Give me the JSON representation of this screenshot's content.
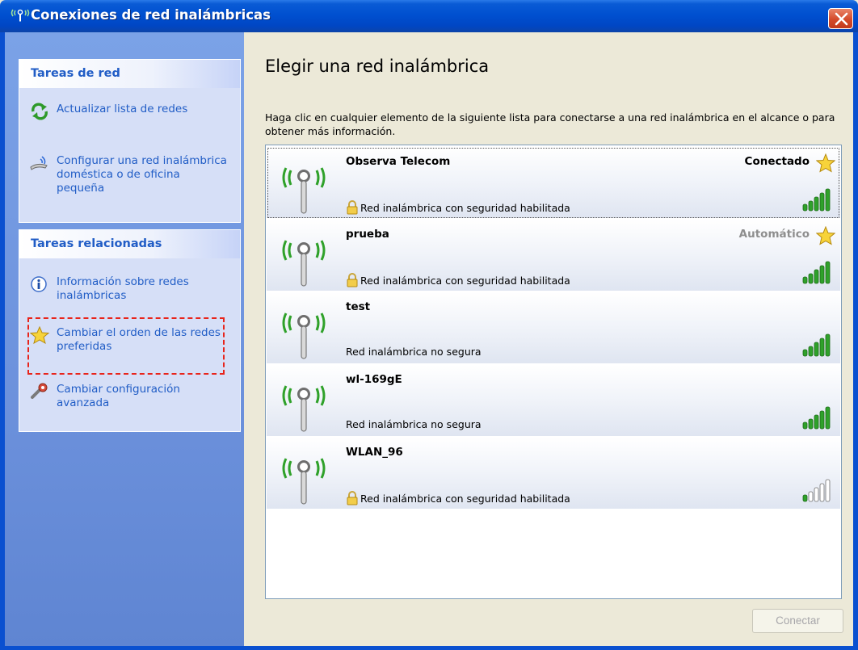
{
  "window": {
    "title": "Conexiones de red inalámbricas",
    "close_icon": "close-icon"
  },
  "tasks_network": {
    "heading": "Tareas de red",
    "items": [
      {
        "icon": "refresh-icon",
        "label": "Actualizar lista de redes"
      },
      {
        "icon": "wireless-setup-icon",
        "label": "Configurar una red inalámbrica doméstica o de oficina pequeña"
      }
    ]
  },
  "tasks_related": {
    "heading": "Tareas relacionadas",
    "items": [
      {
        "icon": "info-icon",
        "label": "Información sobre redes inalámbricas"
      },
      {
        "icon": "star-icon",
        "label": "Cambiar el orden de las redes preferidas"
      },
      {
        "icon": "settings-icon",
        "label": "Cambiar configuración avanzada"
      }
    ]
  },
  "main": {
    "title": "Elegir una red inalámbrica",
    "description": "Haga clic en cualquier elemento de la siguiente lista para conectarse a una red inalámbrica en el alcance o para obtener más información.",
    "connect_button": "Conectar"
  },
  "networks": [
    {
      "name": "Observa Telecom",
      "status": "Conectado",
      "status_color": "#000000",
      "security": "Red inalámbrica con seguridad habilitada",
      "secured": true,
      "signal_bars": 5,
      "preferred": true,
      "selected": true
    },
    {
      "name": "prueba",
      "status": "Automático",
      "status_color": "#8e8e8e",
      "security": "Red inalámbrica con seguridad habilitada",
      "secured": true,
      "signal_bars": 5,
      "preferred": true,
      "selected": false
    },
    {
      "name": "test",
      "status": "",
      "status_color": "#000000",
      "security": "Red inalámbrica no segura",
      "secured": false,
      "signal_bars": 5,
      "preferred": false,
      "selected": false
    },
    {
      "name": "wl-169gE",
      "status": "",
      "status_color": "#000000",
      "security": "Red inalámbrica no segura",
      "secured": false,
      "signal_bars": 5,
      "preferred": false,
      "selected": false
    },
    {
      "name": "WLAN_96",
      "status": "",
      "status_color": "#000000",
      "security": "Red inalámbrica con seguridad habilitada",
      "secured": true,
      "signal_bars": 1,
      "preferred": false,
      "selected": false
    }
  ],
  "colors": {
    "accent_link": "#215dc6",
    "signal_on": "#2fa12a",
    "signal_off": "#ffffff",
    "highlight_box": "#e8241b"
  }
}
